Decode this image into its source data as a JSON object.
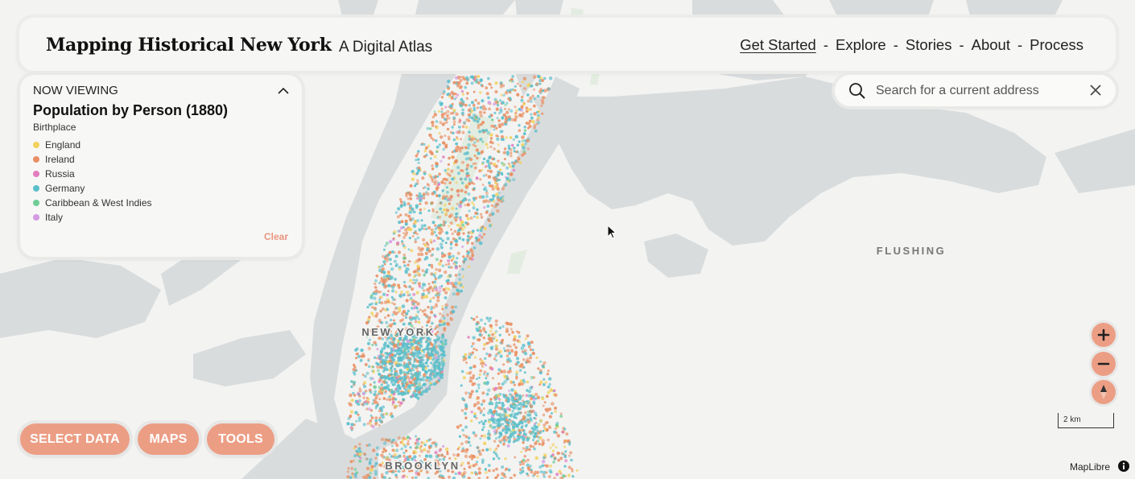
{
  "header": {
    "title": "Mapping Historical New York",
    "subtitle": "A Digital Atlas",
    "nav": [
      {
        "label": "Get Started",
        "active": true
      },
      {
        "label": "Explore"
      },
      {
        "label": "Stories"
      },
      {
        "label": "About"
      },
      {
        "label": "Process"
      }
    ],
    "separator": "-"
  },
  "legend": {
    "now_viewing": "NOW VIEWING",
    "title": "Population by Person (1880)",
    "subtitle": "Birthplace",
    "items": [
      {
        "label": "England",
        "color": "#f2d15c"
      },
      {
        "label": "Ireland",
        "color": "#e98f63"
      },
      {
        "label": "Russia",
        "color": "#e27cbe"
      },
      {
        "label": "Germany",
        "color": "#5bbfcb"
      },
      {
        "label": "Caribbean & West Indies",
        "color": "#6fcd97"
      },
      {
        "label": "Italy",
        "color": "#d59ae3"
      }
    ],
    "clear_label": "Clear"
  },
  "search": {
    "placeholder": "Search for a current address",
    "value": ""
  },
  "map": {
    "labels": {
      "flushing": "FLUSHING",
      "new_york": "NEW YORK",
      "brooklyn": "BROOKLYN"
    },
    "scale_label": "2 km",
    "attribution": "MapLibre"
  },
  "buttons": {
    "select_data": "SELECT DATA",
    "maps": "MAPS",
    "tools": "TOOLS"
  },
  "colors": {
    "accent": "#ec9e85",
    "water": "#d9dcdd",
    "land": "#f3f3f2",
    "park": "#e3ece0"
  },
  "icons": {
    "search": "search-icon",
    "clear_search": "close-icon",
    "collapse": "chevron-up-icon",
    "zoom_in": "plus-icon",
    "zoom_out": "minus-icon",
    "compass": "compass-icon",
    "info": "info-icon"
  }
}
